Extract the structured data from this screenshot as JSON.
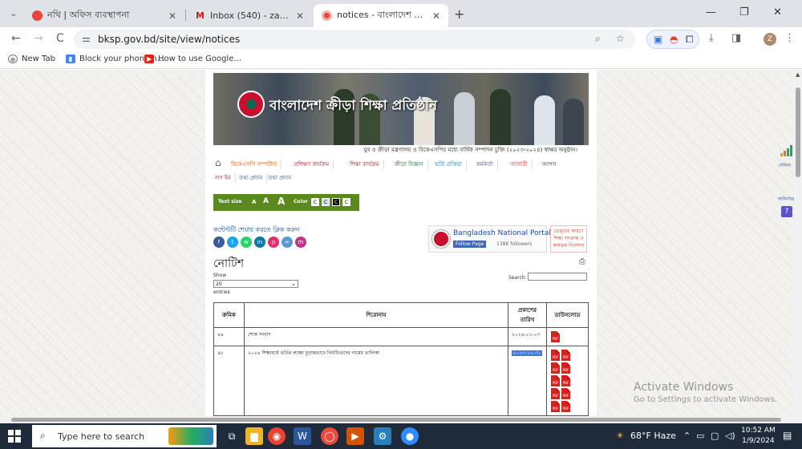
{
  "browser": {
    "tabs": [
      {
        "title": "নথি | অফিস ব্যবস্থাপনা",
        "favicon_color": "#e8453c",
        "active": false
      },
      {
        "title": "Inbox (540) - zahir91975@gma...",
        "favicon_color": "#c5221f",
        "favicon_glyph": "M",
        "active": false
      },
      {
        "title": "notices - বাংলাদেশ ক্রীড়া শিক্ষা",
        "favicon_color": "#e8453c",
        "active": true
      }
    ],
    "tab_close": "✕",
    "new_tab": "+",
    "window_controls": {
      "minimize": "—",
      "restore": "❐",
      "close": "✕"
    },
    "nav": {
      "back": "←",
      "forward": "→",
      "reload": "C"
    },
    "url": "bksp.gov.bd/site/view/notices",
    "bookmarks": [
      {
        "label": "New Tab",
        "icon": "globe-icon"
      },
      {
        "label": "Block your phone n...",
        "icon": "phone-icon"
      },
      {
        "label": "How to use Google...",
        "icon": "youtube-icon"
      }
    ],
    "profile_initial": "Z"
  },
  "site": {
    "banner_title": "বাংলাদেশ ক্রীড়া শিক্ষা প্রতিষ্ঠান",
    "banner_caption": "যুব ও ক্রীড়া মন্ত্রণালয় ও বিকেএসপির মধ্যে বার্ষিক সম্পাদন চুক্তি (২০২৩-২০২৪) স্বাক্ষর অনুষ্ঠান।",
    "nav_row1": [
      {
        "label": "বিকেএসপি সম্পর্কিত",
        "color": "#d35400"
      },
      {
        "label": "প্রশিক্ষণ কার্যক্রম",
        "color": "#8e2424"
      },
      {
        "label": "শিক্ষা কার্যক্রম",
        "color": "#8e2424"
      },
      {
        "label": "ক্রীড়া বিজ্ঞান",
        "color": "#27612f"
      },
      {
        "label": "ভর্তি প্রক্রিয়া",
        "color": "#1f6f9a"
      },
      {
        "label": "কর্মকর্তা",
        "color": "#5b3f8f"
      },
      {
        "label": "গ্যালারী",
        "color": "#c0392b"
      },
      {
        "label": "আপস",
        "color": "#333333"
      }
    ],
    "nav_row2": [
      {
        "label": "লগ ইন",
        "color": "#8e2424"
      },
      {
        "label": "তথ্য প্রদান",
        "color": "#1f4e9a"
      },
      {
        "label": "তথ্য প্রদান",
        "color": "#1f4e9a"
      }
    ],
    "accessibility": {
      "text_size_label": "Text size",
      "sizes": [
        "A",
        "A",
        "A"
      ],
      "color_label": "Color",
      "swatches": [
        "C",
        "C",
        "C",
        "C"
      ]
    },
    "share_text": "কন্টেন্টটি শেয়ার করতে ক্লিক করুন",
    "share_buttons": [
      {
        "glyph": "f",
        "color": "#3b5998",
        "name": "facebook"
      },
      {
        "glyph": "t",
        "color": "#1da1f2",
        "name": "twitter"
      },
      {
        "glyph": "w",
        "color": "#25d366",
        "name": "whatsapp"
      },
      {
        "glyph": "in",
        "color": "#0e76a8",
        "name": "linkedin"
      },
      {
        "glyph": "p",
        "color": "#e1306c",
        "name": "pinterest"
      },
      {
        "glyph": "∞",
        "color": "#5b9bd5",
        "name": "link"
      },
      {
        "glyph": "m",
        "color": "#c13584",
        "name": "messenger"
      }
    ],
    "portal": {
      "title": "Bangladesh National Portal",
      "follow": "Follow Page",
      "followers": "138K followers"
    },
    "side_link": "ডেঙ্গুর কারণে শিক্ষা সংক্রান্ত ও কার্যক্রম নির্দেশনা",
    "page_heading": "নোটিশ",
    "show_label": "Show",
    "show_value": "20",
    "entries_label": "entries",
    "search_label": "Search:",
    "table": {
      "headers": [
        "ক্রমিক",
        "শিরোনাম",
        "প্রকাশের তারিখ",
        "ডাউনলোড"
      ],
      "rows": [
        {
          "serial": "৪৯",
          "title": "শোক সংবাদ",
          "date": "২০২৪-০১-০৩",
          "pdfs": 1,
          "date_highlight": false
        },
        {
          "serial": "৪৮",
          "title": "২০২৪ শিক্ষাবর্ষে ভর্তির লক্ষ্যে চূড়ান্তভাবে নির্বাচিতদের নামের তালিকা",
          "date": "২০২৩-১২-৩১",
          "pdfs": 10,
          "date_highlight": true
        }
      ],
      "pdf_label": "PDF"
    },
    "right_widget": {
      "label_top": "সেলিম",
      "label_mid": "অফিসার"
    }
  },
  "watermark": {
    "line1": "Activate Windows",
    "line2": "Go to Settings to activate Windows."
  },
  "taskbar": {
    "search_placeholder": "Type here to search",
    "apps": [
      {
        "glyph": "⧉",
        "color": "#1f2a3a",
        "name": "task-view"
      },
      {
        "glyph": "▆",
        "color": "#f0b429",
        "name": "file-explorer"
      },
      {
        "glyph": "◉",
        "color": "#e94235",
        "name": "chrome"
      },
      {
        "glyph": "W",
        "color": "#2b579a",
        "name": "word"
      },
      {
        "glyph": "◯",
        "color": "#e74c3c",
        "name": "opera"
      },
      {
        "glyph": "▶",
        "color": "#d35400",
        "name": "media"
      },
      {
        "glyph": "⚙",
        "color": "#2980b9",
        "name": "app-settings"
      },
      {
        "glyph": "●",
        "color": "#2d8cff",
        "name": "zoom"
      }
    ],
    "weather": "68°F  Haze",
    "time": "10:52 AM",
    "date": "1/9/2024"
  }
}
